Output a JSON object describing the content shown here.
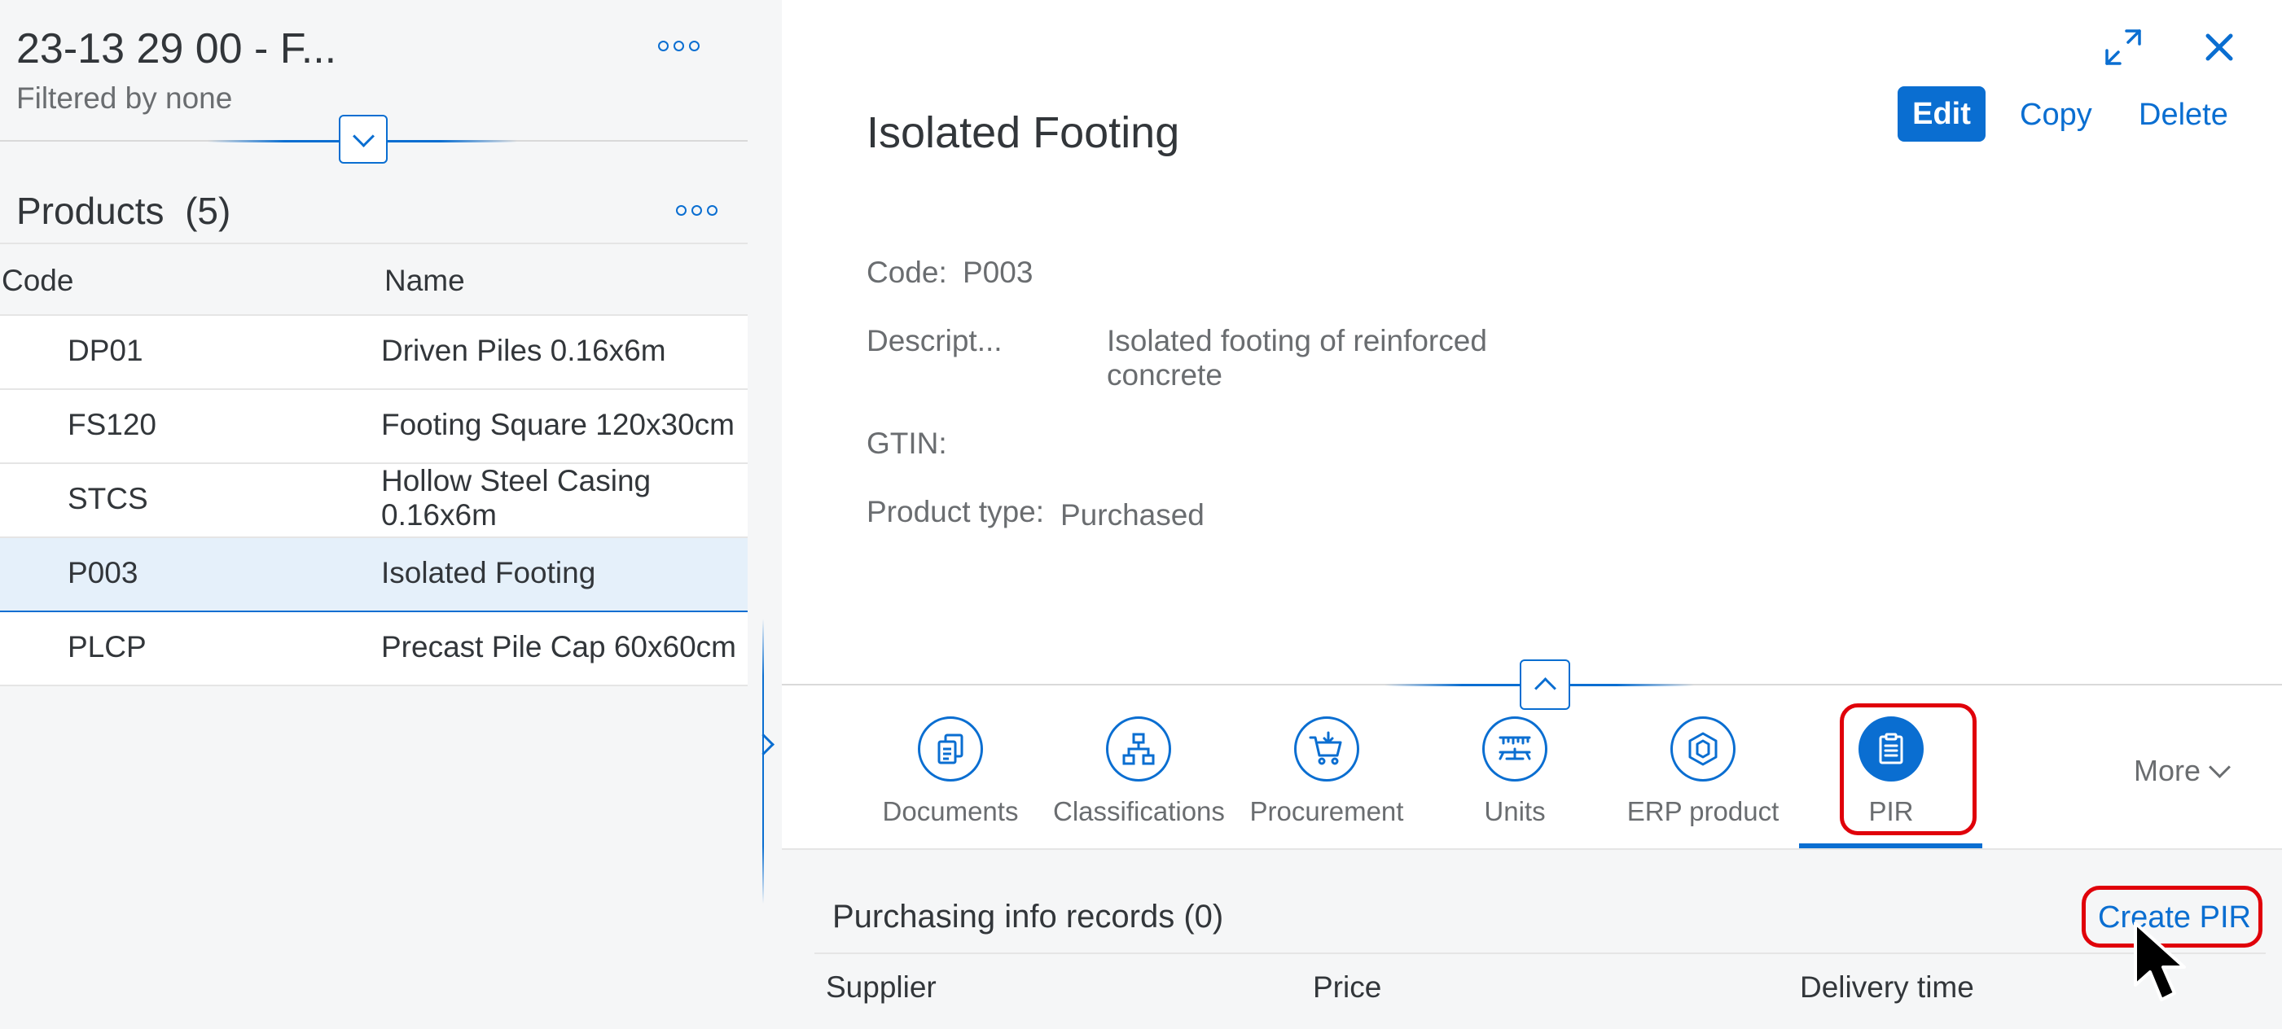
{
  "master": {
    "title": "23-13 29 00 - F...",
    "subtitle": "Filtered by none",
    "list_title": "Products",
    "list_count": "(5)",
    "columns": [
      "Code",
      "Name"
    ],
    "rows": [
      {
        "code": "DP01",
        "name": "Driven Piles 0.16x6m"
      },
      {
        "code": "FS120",
        "name": "Footing Square 120x30cm"
      },
      {
        "code": "STCS",
        "name": "Hollow Steel Casing 0.16x6m"
      },
      {
        "code": "P003",
        "name": "Isolated Footing"
      },
      {
        "code": "PLCP",
        "name": "Precast Pile Cap 60x60cm"
      }
    ],
    "selected_index": 3
  },
  "detail": {
    "title": "Isolated Footing",
    "actions": {
      "edit": "Edit",
      "copy": "Copy",
      "delete": "Delete"
    },
    "fields": {
      "code_label": "Code:",
      "code_value": "P003",
      "desc_label": "Descript...",
      "desc_value": "Isolated footing of reinforced concrete",
      "gtin_label": "GTIN:",
      "gtin_value": "",
      "type_label": "Product type:",
      "type_value": "Purchased"
    },
    "tabs": [
      {
        "label": "Documents",
        "icon": "documents-icon"
      },
      {
        "label": "Classifications",
        "icon": "hierarchy-icon"
      },
      {
        "label": "Procurement",
        "icon": "cart-icon"
      },
      {
        "label": "Units",
        "icon": "ruler-scale-icon"
      },
      {
        "label": "ERP product",
        "icon": "product-icon"
      },
      {
        "label": "PIR",
        "icon": "clipboard-icon"
      }
    ],
    "active_tab": "PIR",
    "more_label": "More",
    "section": {
      "title": "Purchasing info records (0)",
      "create_label": "Create PIR",
      "columns": [
        "Supplier",
        "Price",
        "Delivery time"
      ]
    }
  },
  "colors": {
    "accent": "#0a6ed1",
    "highlight": "#e0000a",
    "text": "#32363a",
    "muted": "#6a6d70"
  }
}
